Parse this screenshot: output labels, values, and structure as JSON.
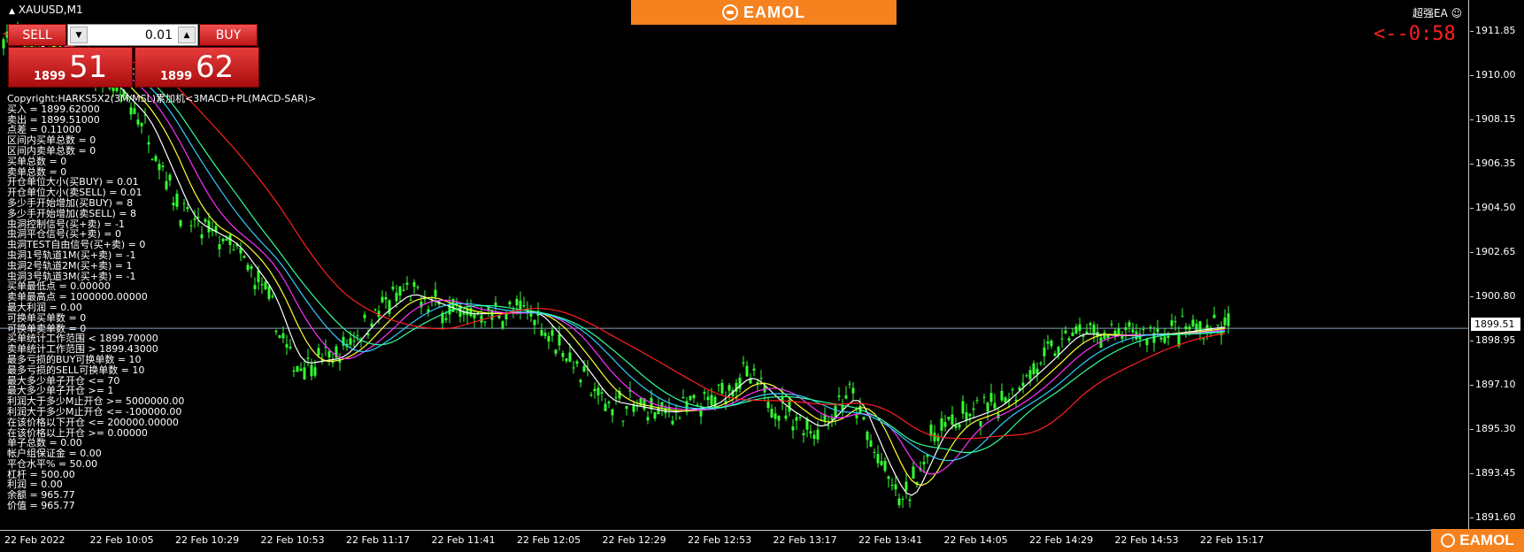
{
  "symbol": "XAUUSD,M1",
  "brand": {
    "banner_text": "EAMOL",
    "corner_text": "EAMOL"
  },
  "ea": {
    "name": "超强EA",
    "countdown": "<--0:58"
  },
  "trade_panel": {
    "sell_label": "SELL",
    "buy_label": "BUY",
    "lot_value": "0.01",
    "sell_price_big": "1899",
    "sell_price_small": "51",
    "buy_price_big": "1899",
    "buy_price_small": "62"
  },
  "info_lines": [
    "Copyright:HARKS5X2(3M/MSL)累加机<3MACD+PL(MACD-SAR)>",
    "买入 = 1899.62000",
    "卖出 = 1899.51000",
    "点差 = 0.11000",
    "区间内买单总数 = 0",
    "区间内卖单总数 = 0",
    "买单总数 = 0",
    "卖单总数 = 0",
    "开仓单位大小(买BUY) = 0.01",
    "开仓单位大小(卖SELL) = 0.01",
    "多少手开始增加(买BUY) = 8",
    "多少手开始增加(卖SELL) = 8",
    "虫洞控制信号(买+卖) = -1",
    "虫洞平仓信号(买+卖) = 0",
    "虫洞TEST自由信号(买+卖) = 0",
    "虫洞1号轨道1M(买+卖) = -1",
    "虫洞2号轨道2M(买+卖) = 1",
    "虫洞3号轨道3M(买+卖) = -1",
    "买单最低点 = 0.00000",
    "卖单最高点 = 1000000.00000",
    "最大利润 = 0.00",
    "可换单买单数 = 0",
    "可换单卖单数 = 0",
    "买单统计工作范围 < 1899.70000",
    "卖单统计工作范围 > 1899.43000",
    "最多亏损的BUY可换单数 = 10",
    "最多亏损的SELL可换单数 = 10",
    "最大多少单子开仓 <= 70",
    "最大多少单子开仓 >= 1",
    "利润大于多少M止开仓 >= 5000000.00",
    "利润大于多少M止开仓 <= -100000.00",
    "在该价格以下开仓 <= 200000.00000",
    "在该价格以上开仓 >= 0.00000",
    "单子总数 = 0.00",
    "帐户组保证金 = 0.00",
    "平仓水平% = 50.00",
    "杠杆 = 500.00",
    "利润 = 0.00",
    "余额 = 965.77",
    "价值 = 965.77"
  ],
  "price_axis": [
    "1911.85",
    "1910.00",
    "1908.15",
    "1906.35",
    "1904.50",
    "1902.65",
    "1900.80",
    "1898.95",
    "1897.10",
    "1895.30",
    "1893.45",
    "1891.60"
  ],
  "current_price": "1899.51",
  "time_axis": [
    "22 Feb 2022",
    "22 Feb 10:05",
    "22 Feb 10:29",
    "22 Feb 10:53",
    "22 Feb 11:17",
    "22 Feb 11:41",
    "22 Feb 12:05",
    "22 Feb 12:29",
    "22 Feb 12:53",
    "22 Feb 13:17",
    "22 Feb 13:41",
    "22 Feb 14:05",
    "22 Feb 14:29",
    "22 Feb 14:53",
    "22 Feb 15:17"
  ],
  "colors": {
    "candle": "#33ff33",
    "ma1": "#ffffff",
    "ma2": "#ffff33",
    "ma3": "#ff33ff",
    "ma4": "#33ccff",
    "ma5": "#33ff99",
    "ma6": "#ff2020",
    "accent": "#f5821f"
  }
}
